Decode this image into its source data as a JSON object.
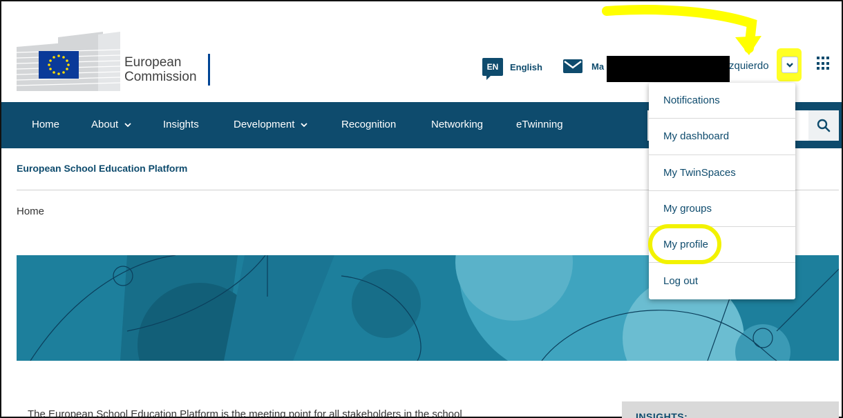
{
  "header": {
    "logo_text_line1": "European",
    "logo_text_line2": "Commission",
    "lang_code": "EN",
    "lang_label": "English",
    "mail_label": "Ma",
    "user_name_visible": "zquierdo"
  },
  "nav": {
    "items": [
      {
        "label": "Home"
      },
      {
        "label": "About"
      },
      {
        "label": "Insights"
      },
      {
        "label": "Development"
      },
      {
        "label": "Recognition"
      },
      {
        "label": "Networking"
      },
      {
        "label": "eTwinning"
      }
    ]
  },
  "site_title": "European School Education Platform",
  "breadcrumb": "Home",
  "dropdown": {
    "items": [
      {
        "label": "Notifications"
      },
      {
        "label": "My dashboard"
      },
      {
        "label": "My TwinSpaces"
      },
      {
        "label": "My groups"
      },
      {
        "label": "My profile"
      },
      {
        "label": "Log out"
      }
    ]
  },
  "intro_text": "The European School Education Platform is the meeting point for all stakeholders in the school",
  "sidebar": {
    "title": "INSIGHTS:"
  },
  "colors": {
    "brand": "#0e4b6d",
    "hero": "#1d7f9c",
    "highlight": "#ffff00"
  },
  "icons": {
    "mail": "envelope-icon",
    "apps": "grid-icon",
    "search": "search-icon",
    "caret": "chevron-down-icon"
  }
}
